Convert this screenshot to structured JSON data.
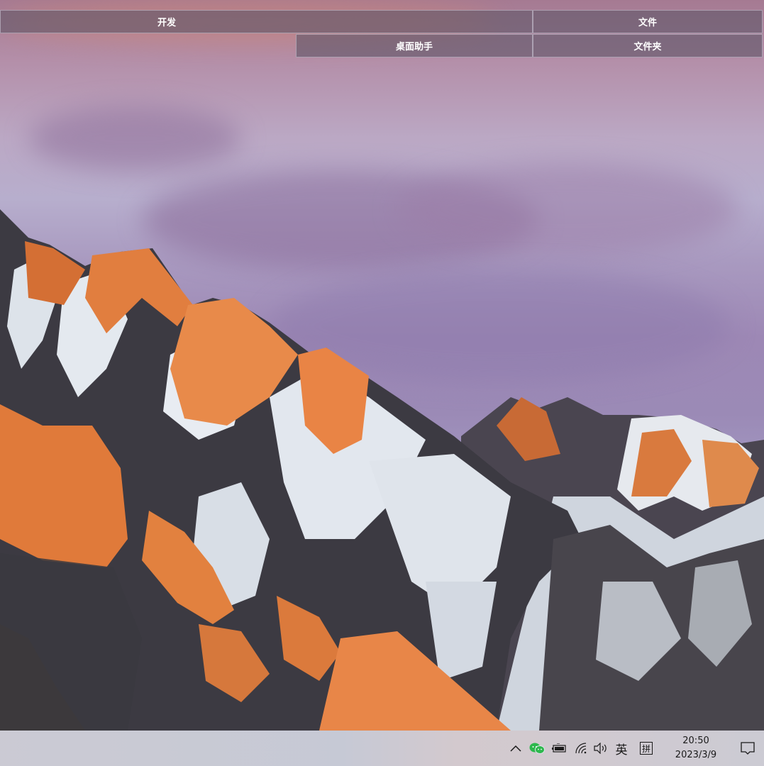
{
  "toolbar": {
    "row1": [
      {
        "label": "开发"
      },
      {
        "label": "文件"
      }
    ],
    "row2": [
      {
        "label": "桌面助手"
      },
      {
        "label": "文件夹"
      }
    ]
  },
  "taskbar": {
    "tray_icons": [
      "chevron-up-icon",
      "wechat-icon",
      "battery-icon",
      "wifi-icon",
      "volume-icon"
    ],
    "ime_language": "英",
    "ime_mode": "拼",
    "time": "20:50",
    "date": "2023/3/9",
    "notification_icon": "action-center-icon"
  },
  "wallpaper": {
    "description_colors": {
      "sky_top": "#a57a92",
      "sky_mid": "#b7aecd",
      "alpenglow": "#e07a3a",
      "snow": "#e8ecf2",
      "rock": "#3e3b40"
    }
  }
}
